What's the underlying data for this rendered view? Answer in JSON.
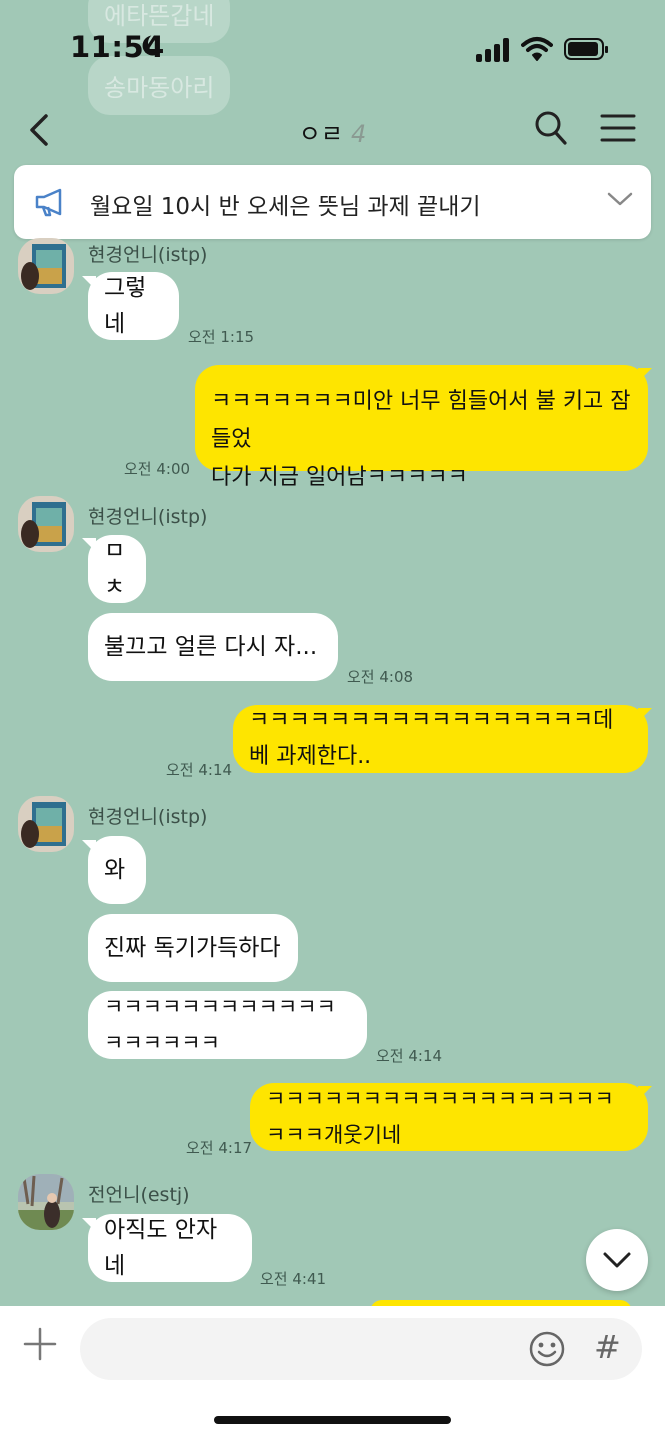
{
  "status_bar": {
    "time": "11:54"
  },
  "ghost_messages": [
    "에타뜬갑네",
    "송마동아리"
  ],
  "header": {
    "title": "ㅇㄹ",
    "member_count": "4"
  },
  "notice": {
    "text": "월요일 10시 반 오세은 뜻님 과제 끝내기"
  },
  "users": {
    "hyun": {
      "name": "현경언니(istp)"
    },
    "jeon": {
      "name": "전언니(estj)"
    }
  },
  "messages": [
    {
      "text": "그렇네",
      "time": "오전 1:15"
    },
    {
      "line1": "ㅋㅋㅋㅋㅋㅋㅋ미안 너무 힘들어서 불 키고 잠들었",
      "line2": "다가 지금 일어남ㅋㅋㅋㅋㅋ",
      "time": "오전 4:00"
    },
    {
      "text": "ㅁㅊ"
    },
    {
      "text": "불끄고 얼른 다시 자...",
      "time": "오전 4:08"
    },
    {
      "text": "ㅋㅋㅋㅋㅋㅋㅋㅋㅋㅋㅋㅋㅋㅋㅋㅋㅋ데베 과제한다..",
      "time": "오전 4:14"
    },
    {
      "text": "와"
    },
    {
      "text": "진짜 독기가득하다"
    },
    {
      "text": "ㅋㅋㅋㅋㅋㅋㅋㅋㅋㅋㅋㅋㅋㅋㅋㅋㅋㅋ",
      "time": "오전 4:14"
    },
    {
      "text": "ㅋㅋㅋㅋㅋㅋㅋㅋㅋㅋㅋㅋㅋㅋㅋㅋㅋㅋㅋㅋㅋ개웃기네",
      "time": "오전 4:17"
    },
    {
      "text": "아직도 안자네",
      "time": "오전 4:41"
    }
  ],
  "input": {
    "hash_label": "#"
  },
  "icons": {
    "back": "chevron-left-icon",
    "search": "search-icon",
    "menu": "menu-icon",
    "notice": "megaphone-icon",
    "expand": "chevron-down-icon",
    "add": "plus-icon",
    "emoji": "emoji-icon",
    "scroll": "chevron-down-icon"
  },
  "colors": {
    "background": "#a1c8b6",
    "my_bubble": "#fee500",
    "their_bubble": "#ffffff"
  }
}
